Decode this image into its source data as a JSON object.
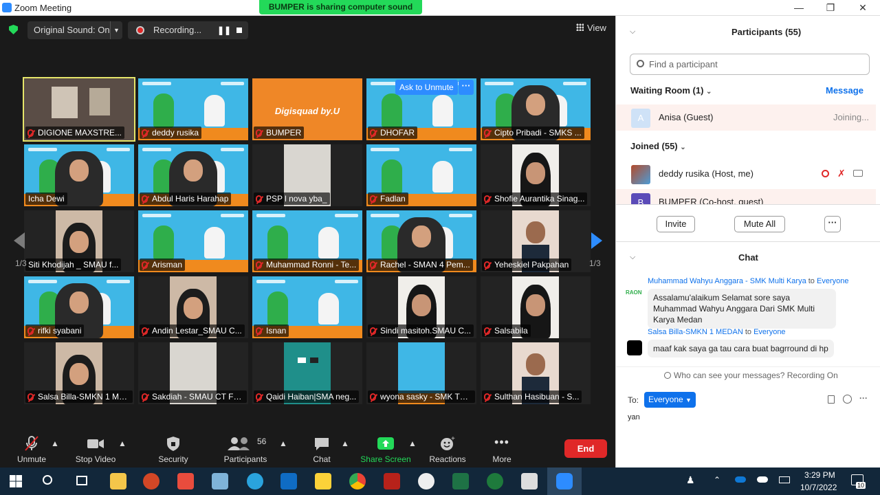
{
  "window": {
    "title": "Zoom Meeting",
    "share_banner": "BUMPER is sharing computer sound"
  },
  "topbar": {
    "original_sound": "Original Sound: On",
    "recording": "Recording...",
    "view": "View"
  },
  "tiles": [
    {
      "name": "DIGIONE MAXSTRE...",
      "kind": "room",
      "active": true,
      "muted": true
    },
    {
      "name": "deddy rusika",
      "kind": "brand",
      "muted": true
    },
    {
      "name": "BUMPER",
      "kind": "orange",
      "muted": true,
      "overlay": "Digisquad by.U"
    },
    {
      "name": "DHOFAR",
      "kind": "brand",
      "muted": true,
      "ask": "Ask to Unmute",
      "more": "···"
    },
    {
      "name": "Cipto Pribadi - SMKS ...",
      "kind": "brand-person",
      "muted": true
    },
    {
      "name": "Icha Dewi",
      "kind": "brand-person",
      "muted": false
    },
    {
      "name": "Abdul Haris Harahap",
      "kind": "brand-person",
      "muted": true
    },
    {
      "name": "PSP l nova yba_",
      "kind": "cam-wall",
      "muted": true
    },
    {
      "name": "Fadlan",
      "kind": "brand",
      "muted": true
    },
    {
      "name": "Shofie Aurantika Sinag...",
      "kind": "cam-hijab-light",
      "muted": true
    },
    {
      "name": "Siti Khodijah _ SMAU f...",
      "kind": "cam-hijab",
      "muted": false
    },
    {
      "name": "Arisman",
      "kind": "brand",
      "muted": true
    },
    {
      "name": "Muhammad Ronni - Te...",
      "kind": "brand",
      "muted": true
    },
    {
      "name": "Rachel - SMAN 4 Pem...",
      "kind": "brand-person",
      "muted": true
    },
    {
      "name": "Yeheskiel Pakpahan",
      "kind": "cam-person",
      "muted": true
    },
    {
      "name": "rifki syabani",
      "kind": "brand-person",
      "muted": true
    },
    {
      "name": "Andin Lestar_SMAU C...",
      "kind": "cam-hijab",
      "muted": true
    },
    {
      "name": "Isnan",
      "kind": "brand",
      "muted": true
    },
    {
      "name": "Sindi masitoh.SMAU C...",
      "kind": "cam-hijab-light",
      "muted": true
    },
    {
      "name": "Salsabila",
      "kind": "cam-hijab-light",
      "muted": true
    },
    {
      "name": "Salsa Billa-SMKN 1 ME...",
      "kind": "cam-hijab",
      "muted": true
    },
    {
      "name": "Sakdiah - SMAU CT FO...",
      "kind": "cam-wall",
      "muted": true
    },
    {
      "name": "Qaidi Haiban|SMA neg...",
      "kind": "cam-teal",
      "muted": true
    },
    {
      "name": "wyona sasky - SMK TRI...",
      "kind": "brand-narrow",
      "muted": true
    },
    {
      "name": "Sulthan Hasibuan - S...",
      "kind": "cam-person",
      "muted": true
    }
  ],
  "pager": {
    "left": "1/3",
    "right": "1/3"
  },
  "toolbar": {
    "unmute": "Unmute",
    "stop_video": "Stop Video",
    "security": "Security",
    "participants": "Participants",
    "participants_count": "56",
    "chat": "Chat",
    "share_screen": "Share Screen",
    "reactions": "Reactions",
    "more": "More",
    "end": "End"
  },
  "participants_panel": {
    "title": "Participants (55)",
    "search_placeholder": "Find a participant",
    "waiting_room": "Waiting Room (1)",
    "message": "Message",
    "waiting": [
      {
        "name": "Anisa (Guest)",
        "status": "Joining...",
        "initial": "A"
      }
    ],
    "joined": "Joined (55)",
    "joined_list": [
      {
        "name": "deddy rusika (Host, me)"
      },
      {
        "name": "BUMPER (Co-host, guest)",
        "initial": "B"
      }
    ],
    "invite": "Invite",
    "mute_all": "Mute All",
    "more": "···"
  },
  "chat": {
    "title": "Chat",
    "messages": [
      {
        "from": "Muhammad Wahyu Anggara - SMK Multi Karya",
        "to_word": "to",
        "to": "Everyone",
        "text": "Assalamu'alaikum Selamat sore saya Muhammad Wahyu Anggara Dari SMK Multi Karya Medan"
      },
      {
        "from": "Salsa Billa-SMKN 1 MEDAN",
        "to_word": "to",
        "to": "Everyone",
        "text": "maaf kak saya ga tau cara buat bagrround di hp"
      }
    ],
    "notice": "Who can see your messages? Recording On",
    "to_label": "To:",
    "to_value": "Everyone",
    "draft": "yan"
  },
  "taskbar": {
    "time": "3:29 PM",
    "date": "10/7/2022",
    "notif": "10"
  },
  "colors": {
    "accent": "#2d8cff",
    "danger": "#e02828",
    "share": "#23d959"
  }
}
